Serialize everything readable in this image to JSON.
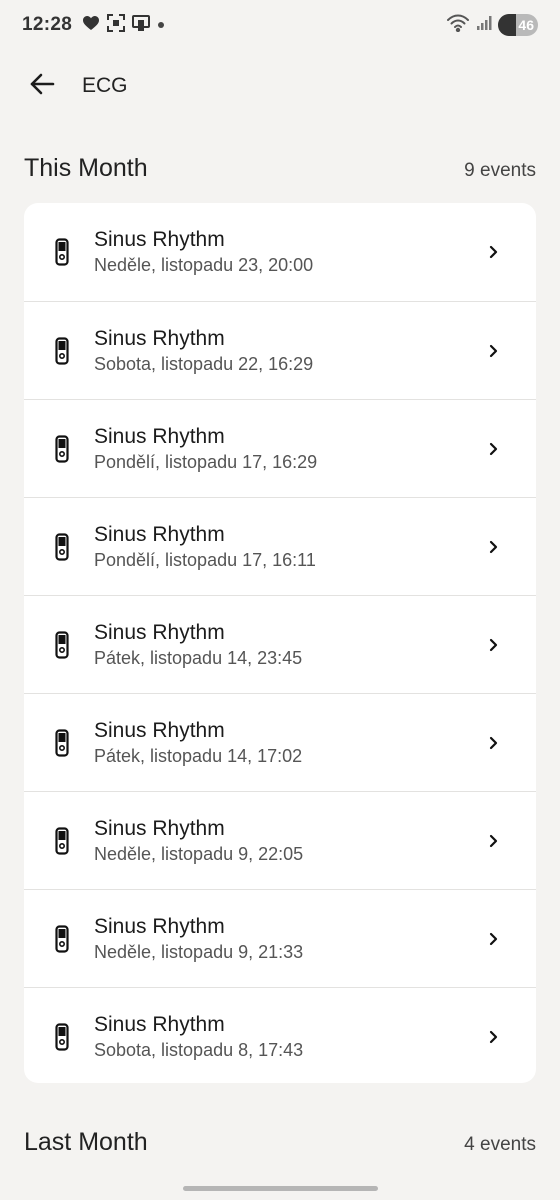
{
  "status_bar": {
    "time": "12:28",
    "battery": "46",
    "icons_left": [
      "heart-icon",
      "scan-icon",
      "cast-icon",
      "dot-icon"
    ],
    "icons_right": [
      "wifi-icon",
      "signal-icon",
      "battery-icon"
    ]
  },
  "app_bar": {
    "title": "ECG",
    "back_icon": "arrow-left-icon"
  },
  "sections": [
    {
      "title": "This Month",
      "count": "9 events",
      "events": [
        {
          "title": "Sinus Rhythm",
          "date": "Neděle, listopadu 23, 20:00"
        },
        {
          "title": "Sinus Rhythm",
          "date": "Sobota, listopadu 22, 16:29"
        },
        {
          "title": "Sinus Rhythm",
          "date": "Pondělí, listopadu 17, 16:29"
        },
        {
          "title": "Sinus Rhythm",
          "date": "Pondělí, listopadu 17, 16:11"
        },
        {
          "title": "Sinus Rhythm",
          "date": "Pátek, listopadu 14, 23:45"
        },
        {
          "title": "Sinus Rhythm",
          "date": "Pátek, listopadu 14, 17:02"
        },
        {
          "title": "Sinus Rhythm",
          "date": "Neděle, listopadu 9, 22:05"
        },
        {
          "title": "Sinus Rhythm",
          "date": "Neděle, listopadu 9, 21:33"
        },
        {
          "title": "Sinus Rhythm",
          "date": "Sobota, listopadu 8, 17:43"
        }
      ]
    },
    {
      "title": "Last Month",
      "count": "4 events"
    }
  ],
  "icons": {
    "row_icon": "watch-icon",
    "row_chevron": "chevron-right-icon"
  }
}
